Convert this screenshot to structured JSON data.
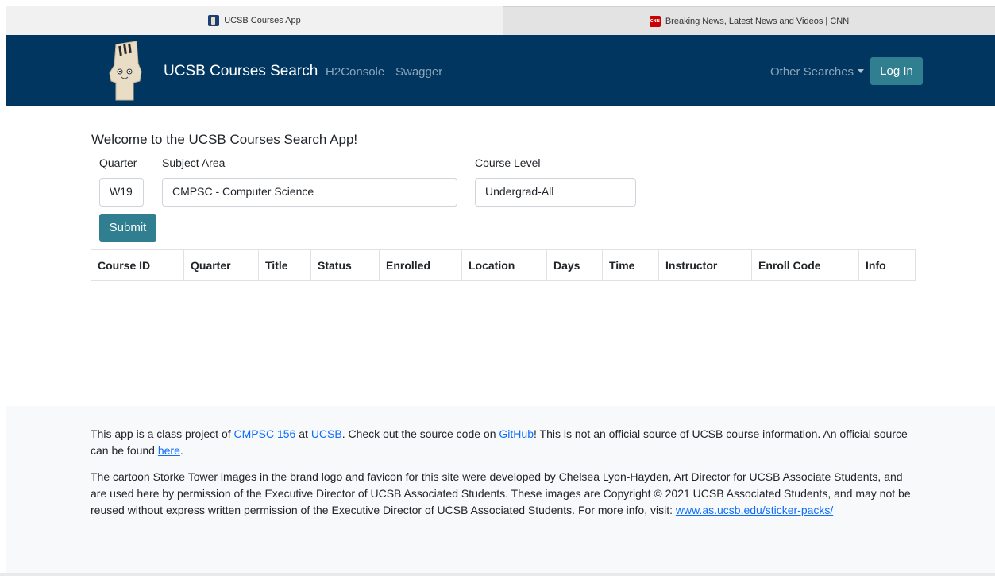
{
  "tabs": [
    {
      "title": "UCSB Courses App",
      "icon": "ucsb-favicon-icon",
      "active": true
    },
    {
      "title": "Breaking News, Latest News and Videos | CNN",
      "icon": "cnn-favicon-icon",
      "icon_text": "CNN",
      "active": false
    }
  ],
  "navbar": {
    "brand": "UCSB Courses Search",
    "links": {
      "h2console": "H2Console",
      "swagger": "Swagger"
    },
    "other_searches": "Other Searches",
    "login": "Log In",
    "background_color": "#003660",
    "button_color": "#2f7f90"
  },
  "main": {
    "welcome": "Welcome to the UCSB Courses Search App!",
    "quarter": {
      "label": "Quarter",
      "value": "W19"
    },
    "subject": {
      "label": "Subject Area",
      "value": "CMPSC - Computer Science"
    },
    "level": {
      "label": "Course Level",
      "value": "Undergrad-All"
    },
    "submit": "Submit"
  },
  "table": {
    "headers": [
      "Course ID",
      "Quarter",
      "Title",
      "Status",
      "Enrolled",
      "Location",
      "Days",
      "Time",
      "Instructor",
      "Enroll Code",
      "Info"
    ]
  },
  "footer": {
    "p1": {
      "t1": "This app is a class project of ",
      "link1": "CMPSC 156",
      "t2": " at ",
      "link2": "UCSB",
      "t3": ". Check out the source code on ",
      "link3": "GitHub",
      "t4": "! This is not an official source of UCSB course information. An official source can be found ",
      "link4": "here",
      "t5": "."
    },
    "p2": {
      "text": "The cartoon Storke Tower images in the brand logo and favicon for this site were developed by Chelsea Lyon-Hayden, Art Director for UCSB Associate Students, and are used here by permission of the Executive Director of UCSB Associated Students. These images are Copyright © 2021 UCSB Associated Students, and may not be reused without express written permission of the Executive Director of UCSB Associated Students. For more info, visit: ",
      "link": "www.as.ucsb.edu/sticker-packs/"
    }
  }
}
